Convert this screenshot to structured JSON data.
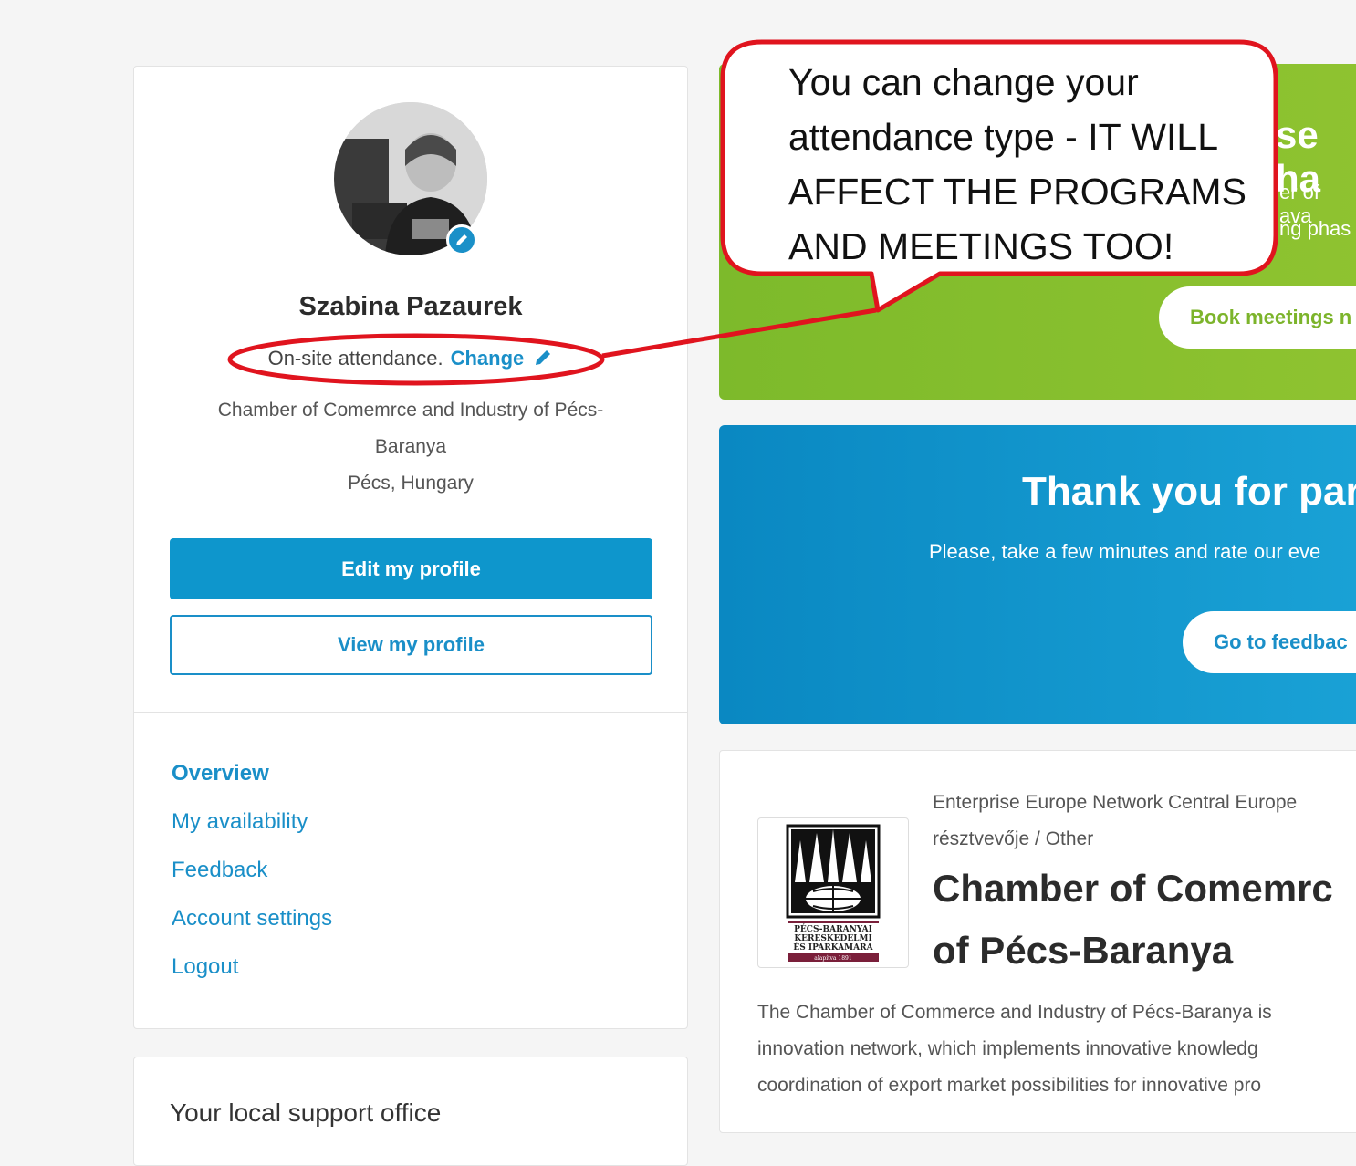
{
  "profile": {
    "name": "Szabina Pazaurek",
    "attendance": "On-site attendance.",
    "change_label": "Change",
    "org_line1": "Chamber of Comemrce and Industry of Pécs-",
    "org_line2": "Baranya",
    "location": "Pécs, Hungary",
    "edit_button": "Edit my profile",
    "view_button": "View my profile"
  },
  "nav": {
    "items": [
      {
        "label": "Overview",
        "active": true
      },
      {
        "label": "My availability"
      },
      {
        "label": "Feedback"
      },
      {
        "label": "Account settings"
      },
      {
        "label": "Logout"
      }
    ]
  },
  "support": {
    "title": "Your local support office"
  },
  "green_banner": {
    "heading_partial": "se ha",
    "line1_partial": "er of ava",
    "line2_partial": "ng phas",
    "button_partial": "Book meetings n"
  },
  "blue_banner": {
    "heading_partial": "Thank you for par",
    "sub_partial": "Please, take a few minutes and rate our eve",
    "button_partial": "Go to feedbac"
  },
  "organization": {
    "category_line1": "Enterprise Europe Network Central Europe",
    "category_line2": "résztvevője / Other",
    "title_line1": "Chamber of Comemrc",
    "title_line2": "of Pécs-Baranya",
    "logo_text1": "PÉCS-BARANYAI",
    "logo_text2": "KERESKEDELMI",
    "logo_text3": "ÉS IPARKAMARA",
    "logo_text4": "alapítva 1891",
    "desc_line1": "The Chamber of Commerce and Industry of Pécs-Baranya is",
    "desc_line2": "innovation network, which implements innovative knowledg",
    "desc_line3": "coordination of export market possibilities for innovative pro"
  },
  "annotation": {
    "line1": "You can change your",
    "line2": "attendance type - IT WILL",
    "line3": "AFFECT THE PROGRAMS",
    "line4": "AND MEETINGS TOO!"
  },
  "colors": {
    "accent_blue": "#0e96cc",
    "banner_green": "#8fc330",
    "annotation_red": "#e0141e"
  }
}
